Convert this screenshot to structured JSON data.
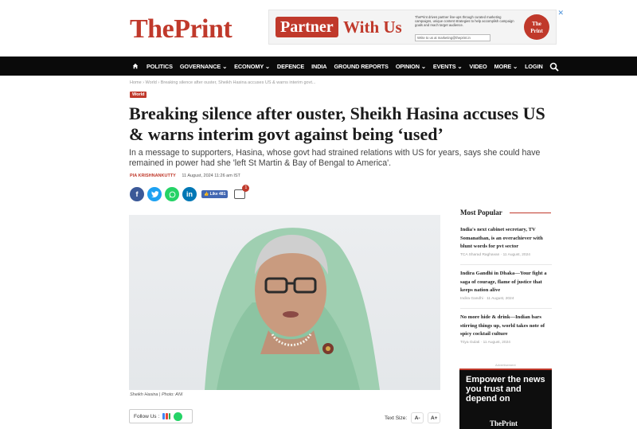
{
  "site": {
    "logo_the": "The",
    "logo_print": "Print"
  },
  "top_ad": {
    "pill": "Partner",
    "with_us": "With Us",
    "desc": "ThePrint drives partner line-ups through curated marketing campaigns, unique content strategies to help accomplish campaign goals and reach target audience.",
    "cta": "Write to us at marketing@theprint.in",
    "circle_the": "The",
    "circle_print": "Print"
  },
  "nav": {
    "items": [
      "POLITICS",
      "GOVERNANCE ⌄",
      "ECONOMY ⌄",
      "DEFENCE",
      "INDIA",
      "GROUND REPORTS",
      "OPINION ⌄",
      "EVENTS ⌄",
      "VIDEO",
      "MORE ⌄",
      "LOGIN"
    ]
  },
  "article": {
    "breadcrumb": "Home › World › Breaking silence after ouster, Sheikh Hasina accuses US & warns interim govt...",
    "tag": "World",
    "headline": "Breaking silence after ouster, Sheikh Hasina accuses US & warns interim govt against being ‘used’",
    "dek": "In a message to supporters, Hasina, whose govt had strained relations with US for years, says she could have remained in power had she 'left St Martin & Bay of Bengal to America'.",
    "author": "PIA KRISHNANKUTTY",
    "date": "11 August, 2024 11:26 am IST",
    "like_label": "👍 Like 481",
    "comment_count": "1",
    "caption": "Sheikh Hasina | Photo: ANI",
    "follow_label": "Follow Us :",
    "text_size_label": "Text Size:",
    "text_smaller": "A-",
    "text_larger": "A+"
  },
  "sidebar": {
    "title": "Most Popular",
    "items": [
      {
        "headline": "India's next cabinet secretary, TV Somanathan, is an overachiever with blunt words for pvt sector",
        "meta": "TCA Sharad Raghavan · 11 August, 2024"
      },
      {
        "headline": "Indira Gandhi in Dhaka—Your fight a saga of courage, flame of justice that keeps nation alive",
        "meta": "Indira Gandhi · 11 August, 2024"
      },
      {
        "headline": "No more hide & drink—Indian bars stirring things up, world takes note of spicy cocktail culture",
        "meta": "Triya Gulati · 11 August, 2024"
      }
    ],
    "ad_label": "Advertisement",
    "ad_text": "Empower the news you trust and depend on",
    "ad_brand": "ThePrint"
  },
  "colors": {
    "brand": "#c0392b",
    "nav_bg": "#0a0a0a"
  }
}
